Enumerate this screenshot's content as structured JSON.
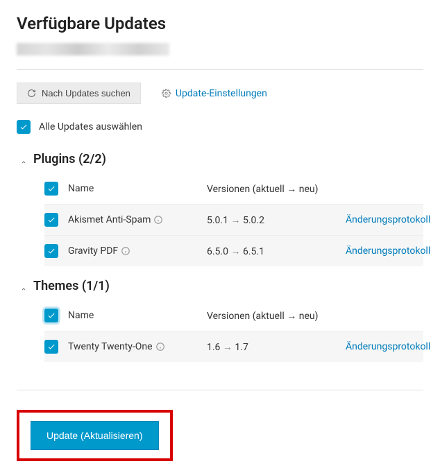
{
  "page": {
    "title": "Verfügbare Updates"
  },
  "toolbar": {
    "check_updates_label": "Nach Updates suchen",
    "settings_link_label": "Update-Einstellungen"
  },
  "select_all": {
    "label": "Alle Updates auswählen"
  },
  "columns": {
    "name": "Name",
    "versions": "Versionen (aktuell → neu)"
  },
  "sections": {
    "plugins": {
      "title": "Plugins (2/2)",
      "rows": [
        {
          "name": "Akismet Anti-Spam",
          "version_current": "5.0.1",
          "version_new": "5.0.2",
          "changelog_label": "Änderungsprotokoll"
        },
        {
          "name": "Gravity PDF",
          "version_current": "6.5.0",
          "version_new": "6.5.1",
          "changelog_label": "Änderungsprotokoll"
        }
      ]
    },
    "themes": {
      "title": "Themes (1/1)",
      "rows": [
        {
          "name": "Twenty Twenty-One",
          "version_current": "1.6",
          "version_new": "1.7",
          "changelog_label": "Änderungsprotokoll"
        }
      ]
    }
  },
  "glyphs": {
    "arrow": "→"
  },
  "footer": {
    "update_button_label": "Update (Aktualisieren)"
  }
}
